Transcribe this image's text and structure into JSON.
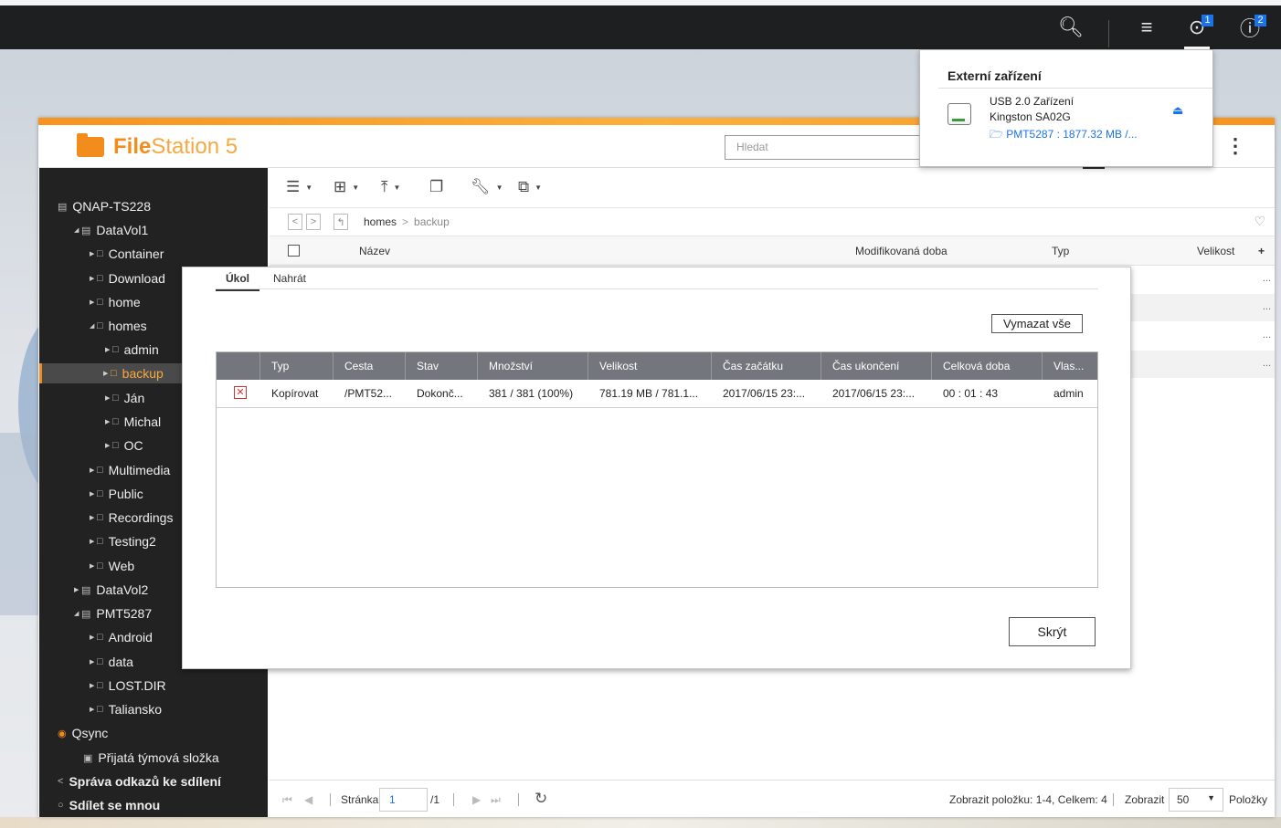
{
  "topbar": {
    "notification_badge": "1",
    "info_badge": "2",
    "icons": [
      "search-icon",
      "stack-icon",
      "external-device-icon",
      "info-icon"
    ]
  },
  "app": {
    "title_bold": "File",
    "title_rest": "Station 5",
    "search_placeholder": "Hledat"
  },
  "sidebar": {
    "root": "QNAP-TS228",
    "datavol1": "DataVol1",
    "items": {
      "container": "Container",
      "download": "Download",
      "home": "home",
      "homes": "homes",
      "admin": "admin",
      "backup": "backup",
      "jan": "Ján",
      "michal": "Michal",
      "oc": "OC",
      "multimedia": "Multimedia",
      "public": "Public",
      "recordings": "Recordings",
      "testing2": "Testing2",
      "web": "Web"
    },
    "datavol2": "DataVol2",
    "pmt": "PMT5287",
    "pmt_items": {
      "android": "Android",
      "data": "data",
      "lost": "LOST.DIR",
      "taliansko": "Taliansko"
    },
    "qsync": "Qsync",
    "team_folder": "Přijatá týmová složka",
    "share_links": "Správa odkazů ke sdílení",
    "shared_with_me": "Sdílet se mnou"
  },
  "breadcrumb": {
    "parent": "homes",
    "separator": ">",
    "current": "backup"
  },
  "columns": {
    "name": "Název",
    "modified": "Modifikovaná doba",
    "type": "Typ",
    "size": "Velikost",
    "add": "+"
  },
  "rows_more": "...",
  "footer": {
    "page_label": "Stránka",
    "page_value": "1",
    "page_total": "/1",
    "summary": "Zobrazit položku: 1-4, Celkem: 4",
    "show_label": "Zobrazit",
    "per_page": "50",
    "items_label": "Položky"
  },
  "dialog": {
    "tab_task": "Úkol",
    "tab_upload": "Nahrát",
    "clear_all": "Vymazat vše",
    "hide": "Skrýt",
    "headers": [
      "Typ",
      "Cesta",
      "Stav",
      "Množství",
      "Velikost",
      "Čas začátku",
      "Čas ukončení",
      "Celková doba",
      "Vlas..."
    ],
    "row": {
      "type": "Kopírovat",
      "path": "/PMT52...",
      "status": "Dokonč...",
      "count": "381 / 381 (100%)",
      "size": "781.19 MB / 781.1...",
      "start": "2017/06/15 23:...",
      "end": "2017/06/15 23:...",
      "duration": "00 : 01 : 43",
      "owner": "admin"
    }
  },
  "popup": {
    "title": "Externí zařízení",
    "device_line1": "USB 2.0 Zařízení",
    "device_line2": "Kingston SA02G",
    "device_link": "PMT5287 : 1877.32 MB /..."
  }
}
